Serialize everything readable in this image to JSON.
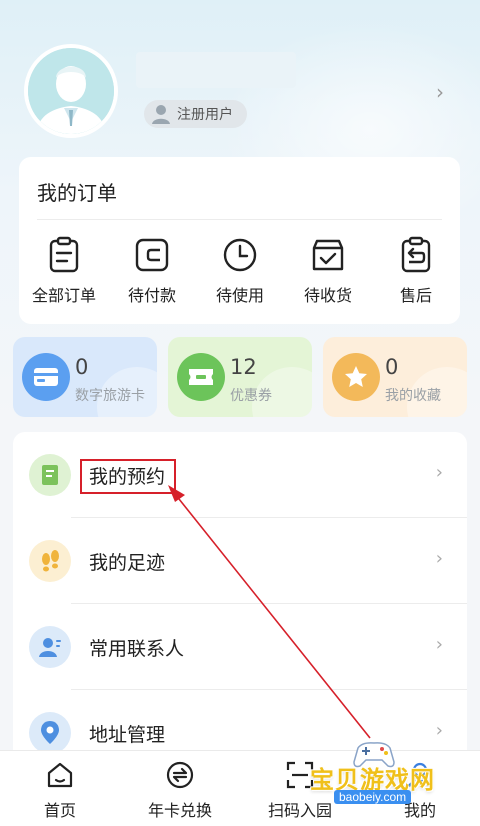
{
  "profile": {
    "badge_label": "注册用户"
  },
  "orders": {
    "title": "我的订单",
    "items": [
      {
        "label": "全部订单",
        "icon": "clipboard-icon"
      },
      {
        "label": "待付款",
        "icon": "wallet-icon"
      },
      {
        "label": "待使用",
        "icon": "clock-icon"
      },
      {
        "label": "待收货",
        "icon": "box-check-icon"
      },
      {
        "label": "售后",
        "icon": "return-icon"
      }
    ]
  },
  "stats": [
    {
      "count": "0",
      "label": "数字旅游卡",
      "icon": "card-icon",
      "bg": "#d9e8fb",
      "circle": "#5b9ff0"
    },
    {
      "count": "12",
      "label": "优惠券",
      "icon": "ticket-icon",
      "bg": "#e4f5d6",
      "circle": "#6cc45a"
    },
    {
      "count": "0",
      "label": "我的收藏",
      "icon": "star-icon",
      "bg": "#fdeedb",
      "circle": "#f3b95a"
    }
  ],
  "menu": [
    {
      "label": "我的预约",
      "icon": "reservation-icon"
    },
    {
      "label": "我的足迹",
      "icon": "footprint-icon"
    },
    {
      "label": "常用联系人",
      "icon": "contacts-icon"
    },
    {
      "label": "地址管理",
      "icon": "location-icon"
    }
  ],
  "tabs": [
    {
      "label": "首页",
      "icon": "home-icon"
    },
    {
      "label": "年卡兑换",
      "icon": "exchange-icon"
    },
    {
      "label": "扫码入园",
      "icon": "scan-icon"
    },
    {
      "label": "我的",
      "icon": "profile-icon"
    }
  ],
  "watermark": {
    "text": "宝贝游戏网",
    "url": "baobeiy.com"
  },
  "colors": {
    "accent_red": "#d6202a",
    "order_icon": "#222222",
    "menu_text": "#222222"
  }
}
